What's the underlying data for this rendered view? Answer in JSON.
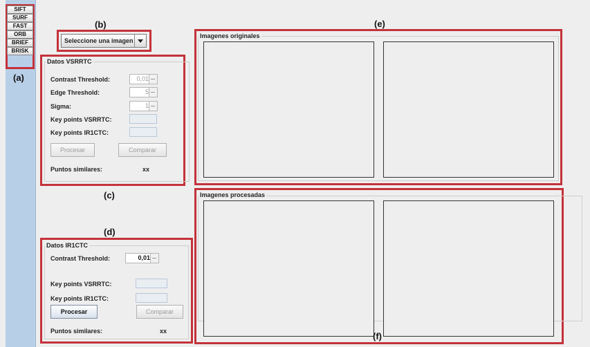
{
  "algorithms": [
    "SIFT",
    "SURF",
    "FAST",
    "ORB",
    "BRIEF",
    "BRISK"
  ],
  "markers": {
    "a": "(a)",
    "b": "(b)",
    "c": "(c)",
    "d": "(d)",
    "e": "(e)",
    "f": "(f)"
  },
  "image_select": {
    "value": "Seleccione una imagen"
  },
  "vsrrtc": {
    "title": "Datos VSRRTC",
    "contrast_label": "Contrast Threshold:",
    "contrast_value": "0,01",
    "edge_label": "Edge Threshold:",
    "edge_value": "5",
    "sigma_label": "Sigma:",
    "sigma_value": "1",
    "kp_vsrrtc_label": "Key points VSRRTC:",
    "kp_ir1ctc_label": "Key points IR1CTC:",
    "process_label": "Procesar",
    "compare_label": "Comparar",
    "similar_label": "Puntos similares:",
    "similar_value": "xx"
  },
  "ir1ctc": {
    "title": "Datos IR1CTC",
    "contrast_label": "Contrast Threshold:",
    "contrast_value": "0,01",
    "kp_vsrrtc_label": "Key points VSRRTC:",
    "kp_ir1ctc_label": "Key points IR1CTC:",
    "process_label": "Procesar",
    "compare_label": "Comparar",
    "similar_label": "Puntos similares:",
    "similar_value": "xx"
  },
  "originals": {
    "title": "Imagenes originales"
  },
  "processed": {
    "title": "Imagenes procesadas"
  }
}
